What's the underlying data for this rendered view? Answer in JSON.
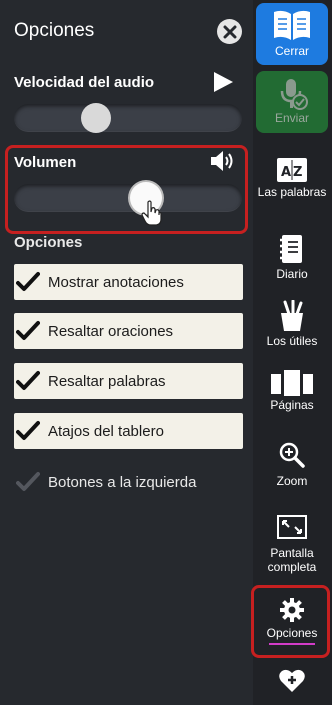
{
  "panel": {
    "title": "Opciones",
    "audio_speed": {
      "label": "Velocidad del audio",
      "value_fraction": 0.36
    },
    "volume": {
      "label": "Volumen",
      "value_fraction": 0.58
    },
    "options_heading": "Opciones",
    "options": [
      {
        "label": "Mostrar anotaciones",
        "checked": true
      },
      {
        "label": "Resaltar oraciones",
        "checked": true
      },
      {
        "label": "Resaltar palabras",
        "checked": true
      },
      {
        "label": "Atajos del tablero",
        "checked": true
      },
      {
        "label": "Botones a la izquierda",
        "checked": false
      }
    ]
  },
  "sidebar": {
    "close_label": "Cerrar",
    "send_label": "Enviar",
    "words_label": "Las palabras",
    "diary_label": "Diario",
    "tools_label": "Los útiles",
    "pages_label": "Páginas",
    "zoom_label": "Zoom",
    "fullscreen_label": "Pantalla completa",
    "options_label": "Opciones"
  },
  "colors": {
    "panel_bg": "#26292e",
    "sidebar_bg": "#202226",
    "close_btn_blue": "#1e7be0",
    "send_btn_green": "#226b33",
    "highlight_red": "#c62020",
    "active_underline": "#d23cc8"
  }
}
